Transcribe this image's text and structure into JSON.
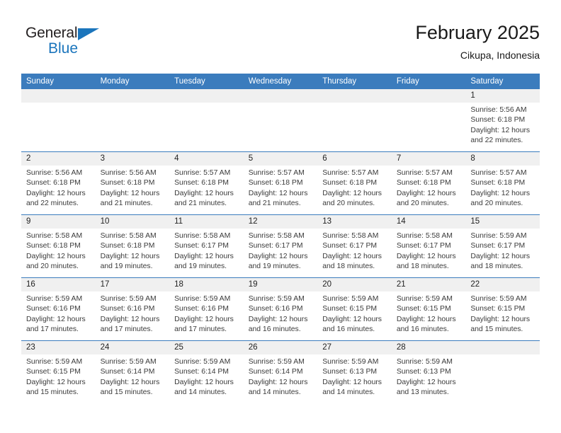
{
  "brand": {
    "name_top": "General",
    "name_bottom": "Blue",
    "triangle_icon": "blue-triangle-icon",
    "color_black": "#231f20",
    "color_blue": "#1b75bc"
  },
  "header": {
    "title": "February 2025",
    "location": "Cikupa, Indonesia"
  },
  "theme": {
    "header_blue": "#3b7cbd",
    "daynum_gray": "#f0f0f0",
    "text": "#222222"
  },
  "calendar": {
    "weekday_headers": [
      "Sunday",
      "Monday",
      "Tuesday",
      "Wednesday",
      "Thursday",
      "Friday",
      "Saturday"
    ],
    "weeks": [
      [
        {
          "day": "",
          "lines": []
        },
        {
          "day": "",
          "lines": []
        },
        {
          "day": "",
          "lines": []
        },
        {
          "day": "",
          "lines": []
        },
        {
          "day": "",
          "lines": []
        },
        {
          "day": "",
          "lines": []
        },
        {
          "day": "1",
          "lines": [
            "Sunrise: 5:56 AM",
            "Sunset: 6:18 PM",
            "Daylight: 12 hours",
            "and 22 minutes."
          ]
        }
      ],
      [
        {
          "day": "2",
          "lines": [
            "Sunrise: 5:56 AM",
            "Sunset: 6:18 PM",
            "Daylight: 12 hours",
            "and 22 minutes."
          ]
        },
        {
          "day": "3",
          "lines": [
            "Sunrise: 5:56 AM",
            "Sunset: 6:18 PM",
            "Daylight: 12 hours",
            "and 21 minutes."
          ]
        },
        {
          "day": "4",
          "lines": [
            "Sunrise: 5:57 AM",
            "Sunset: 6:18 PM",
            "Daylight: 12 hours",
            "and 21 minutes."
          ]
        },
        {
          "day": "5",
          "lines": [
            "Sunrise: 5:57 AM",
            "Sunset: 6:18 PM",
            "Daylight: 12 hours",
            "and 21 minutes."
          ]
        },
        {
          "day": "6",
          "lines": [
            "Sunrise: 5:57 AM",
            "Sunset: 6:18 PM",
            "Daylight: 12 hours",
            "and 20 minutes."
          ]
        },
        {
          "day": "7",
          "lines": [
            "Sunrise: 5:57 AM",
            "Sunset: 6:18 PM",
            "Daylight: 12 hours",
            "and 20 minutes."
          ]
        },
        {
          "day": "8",
          "lines": [
            "Sunrise: 5:57 AM",
            "Sunset: 6:18 PM",
            "Daylight: 12 hours",
            "and 20 minutes."
          ]
        }
      ],
      [
        {
          "day": "9",
          "lines": [
            "Sunrise: 5:58 AM",
            "Sunset: 6:18 PM",
            "Daylight: 12 hours",
            "and 20 minutes."
          ]
        },
        {
          "day": "10",
          "lines": [
            "Sunrise: 5:58 AM",
            "Sunset: 6:18 PM",
            "Daylight: 12 hours",
            "and 19 minutes."
          ]
        },
        {
          "day": "11",
          "lines": [
            "Sunrise: 5:58 AM",
            "Sunset: 6:17 PM",
            "Daylight: 12 hours",
            "and 19 minutes."
          ]
        },
        {
          "day": "12",
          "lines": [
            "Sunrise: 5:58 AM",
            "Sunset: 6:17 PM",
            "Daylight: 12 hours",
            "and 19 minutes."
          ]
        },
        {
          "day": "13",
          "lines": [
            "Sunrise: 5:58 AM",
            "Sunset: 6:17 PM",
            "Daylight: 12 hours",
            "and 18 minutes."
          ]
        },
        {
          "day": "14",
          "lines": [
            "Sunrise: 5:58 AM",
            "Sunset: 6:17 PM",
            "Daylight: 12 hours",
            "and 18 minutes."
          ]
        },
        {
          "day": "15",
          "lines": [
            "Sunrise: 5:59 AM",
            "Sunset: 6:17 PM",
            "Daylight: 12 hours",
            "and 18 minutes."
          ]
        }
      ],
      [
        {
          "day": "16",
          "lines": [
            "Sunrise: 5:59 AM",
            "Sunset: 6:16 PM",
            "Daylight: 12 hours",
            "and 17 minutes."
          ]
        },
        {
          "day": "17",
          "lines": [
            "Sunrise: 5:59 AM",
            "Sunset: 6:16 PM",
            "Daylight: 12 hours",
            "and 17 minutes."
          ]
        },
        {
          "day": "18",
          "lines": [
            "Sunrise: 5:59 AM",
            "Sunset: 6:16 PM",
            "Daylight: 12 hours",
            "and 17 minutes."
          ]
        },
        {
          "day": "19",
          "lines": [
            "Sunrise: 5:59 AM",
            "Sunset: 6:16 PM",
            "Daylight: 12 hours",
            "and 16 minutes."
          ]
        },
        {
          "day": "20",
          "lines": [
            "Sunrise: 5:59 AM",
            "Sunset: 6:15 PM",
            "Daylight: 12 hours",
            "and 16 minutes."
          ]
        },
        {
          "day": "21",
          "lines": [
            "Sunrise: 5:59 AM",
            "Sunset: 6:15 PM",
            "Daylight: 12 hours",
            "and 16 minutes."
          ]
        },
        {
          "day": "22",
          "lines": [
            "Sunrise: 5:59 AM",
            "Sunset: 6:15 PM",
            "Daylight: 12 hours",
            "and 15 minutes."
          ]
        }
      ],
      [
        {
          "day": "23",
          "lines": [
            "Sunrise: 5:59 AM",
            "Sunset: 6:15 PM",
            "Daylight: 12 hours",
            "and 15 minutes."
          ]
        },
        {
          "day": "24",
          "lines": [
            "Sunrise: 5:59 AM",
            "Sunset: 6:14 PM",
            "Daylight: 12 hours",
            "and 15 minutes."
          ]
        },
        {
          "day": "25",
          "lines": [
            "Sunrise: 5:59 AM",
            "Sunset: 6:14 PM",
            "Daylight: 12 hours",
            "and 14 minutes."
          ]
        },
        {
          "day": "26",
          "lines": [
            "Sunrise: 5:59 AM",
            "Sunset: 6:14 PM",
            "Daylight: 12 hours",
            "and 14 minutes."
          ]
        },
        {
          "day": "27",
          "lines": [
            "Sunrise: 5:59 AM",
            "Sunset: 6:13 PM",
            "Daylight: 12 hours",
            "and 14 minutes."
          ]
        },
        {
          "day": "28",
          "lines": [
            "Sunrise: 5:59 AM",
            "Sunset: 6:13 PM",
            "Daylight: 12 hours",
            "and 13 minutes."
          ]
        },
        {
          "day": "",
          "lines": []
        }
      ]
    ]
  }
}
